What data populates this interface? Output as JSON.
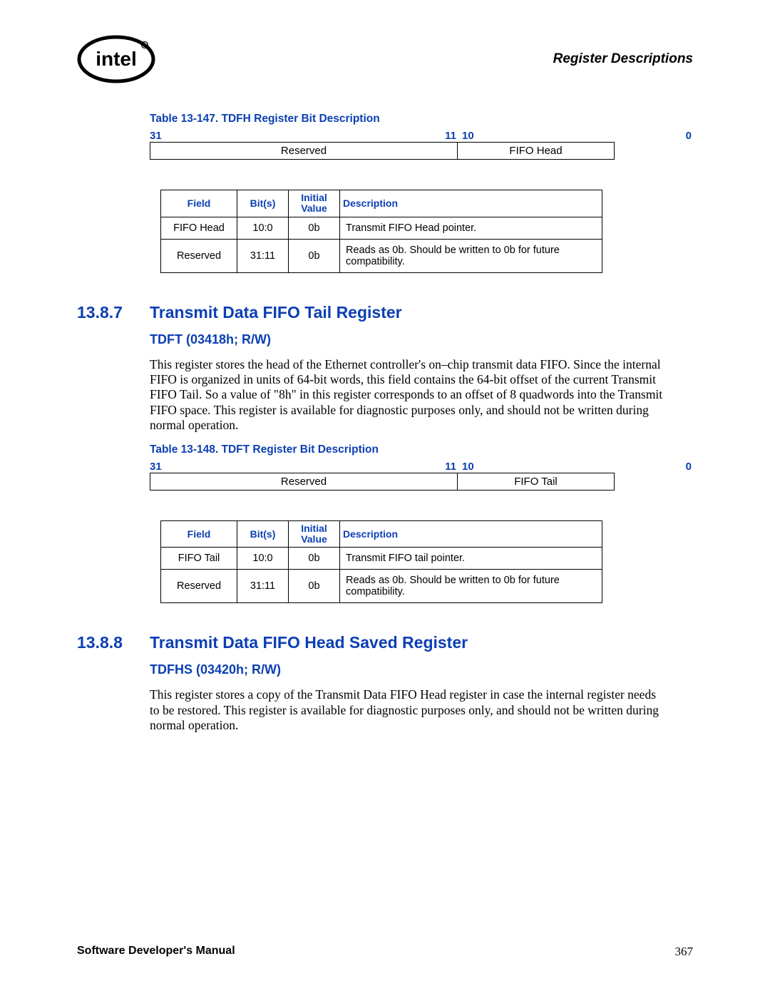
{
  "header": {
    "title": "Register Descriptions"
  },
  "table147": {
    "caption": "Table 13-147. TDFH Register Bit Description",
    "bits": {
      "hi": "31",
      "mid1": "11",
      "mid2": "10",
      "lo": "0"
    },
    "layout_left": "Reserved",
    "layout_right": "FIFO Head",
    "headers": {
      "field": "Field",
      "bits": "Bit(s)",
      "initial": "Initial Value",
      "desc": "Description"
    },
    "rows": [
      {
        "field": "FIFO Head",
        "bits": "10:0",
        "initial": "0b",
        "desc": "Transmit FIFO Head pointer."
      },
      {
        "field": "Reserved",
        "bits": "31:11",
        "initial": "0b",
        "desc": "Reads as 0b. Should be written to 0b for future compatibility."
      }
    ]
  },
  "section1387": {
    "num": "13.8.7",
    "title": "Transmit Data FIFO Tail Register",
    "sub": "TDFT (03418h; R/W)",
    "body": "This register stores the head of the Ethernet controller's on–chip transmit data FIFO. Since the internal FIFO is organized in units of 64-bit words, this field contains the 64-bit offset of the current Transmit FIFO Tail. So a value of \"8h\" in this register corresponds to an offset of 8 quadwords into the Transmit FIFO space. This register is available for diagnostic purposes only, and should not be written during normal operation."
  },
  "table148": {
    "caption": "Table 13-148. TDFT Register Bit Description",
    "bits": {
      "hi": "31",
      "mid1": "11",
      "mid2": "10",
      "lo": "0"
    },
    "layout_left": "Reserved",
    "layout_right": "FIFO Tail",
    "headers": {
      "field": "Field",
      "bits": "Bit(s)",
      "initial": "Initial Value",
      "desc": "Description"
    },
    "rows": [
      {
        "field": "FIFO Tail",
        "bits": "10:0",
        "initial": "0b",
        "desc": "Transmit FIFO tail pointer."
      },
      {
        "field": "Reserved",
        "bits": "31:11",
        "initial": "0b",
        "desc": "Reads as 0b. Should be written to 0b for future compatibility."
      }
    ]
  },
  "section1388": {
    "num": "13.8.8",
    "title": "Transmit Data FIFO Head Saved Register",
    "sub": "TDFHS (03420h; R/W)",
    "body": "This register stores a copy of the Transmit Data FIFO Head register in case the internal register needs to be restored. This register is available for diagnostic purposes only, and should not be written during normal operation."
  },
  "footer": {
    "left": "Software Developer's Manual",
    "right": "367"
  }
}
